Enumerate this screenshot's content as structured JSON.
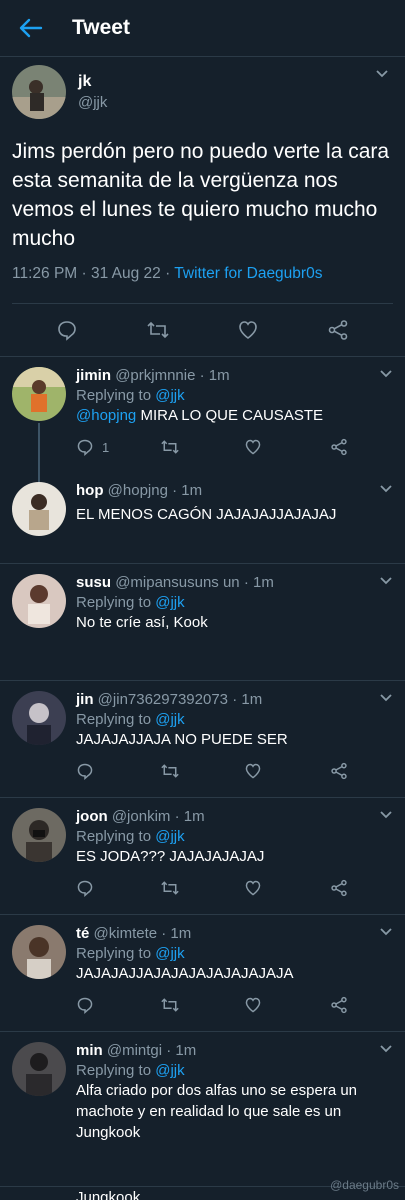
{
  "header": {
    "title": "Tweet"
  },
  "tweet": {
    "name": "jk",
    "handle": "@jjk",
    "text": "Jims perdón pero no puedo verte la cara esta semanita de la vergüenza nos vemos el lunes te quiero mucho mucho mucho",
    "time": "11:26 PM · 31 Aug 22 · ",
    "source": "Twitter for Daegubr0s"
  },
  "replies": [
    {
      "name": "jimin",
      "handle": "@prkjmnnie",
      "time": "· 1m",
      "replying": "Replying to ",
      "replying_to": "@jjk",
      "mention": "@hopjng",
      "text": " MIRA LO QUE CAUSASTE",
      "reply_count": "1"
    },
    {
      "name": "hop",
      "handle": "@hopjng",
      "time": "· 1m",
      "text": "EL MENOS CAGÓN JAJAJAJJAJAJAJ"
    },
    {
      "name": "susu",
      "handle": "@mipansusuns un",
      "time": "· 1m",
      "replying": "Replying to ",
      "replying_to": "@jjk",
      "text": "No te críe así, Kook"
    },
    {
      "name": "jin",
      "handle": "@jin736297392073",
      "time": "· 1m",
      "replying": "Replying to ",
      "replying_to": "@jjk",
      "text": "JAJAJAJJAJA NO PUEDE SER"
    },
    {
      "name": "joon",
      "handle": "@jonkim",
      "time": "· 1m",
      "replying": "Replying to ",
      "replying_to": "@jjk",
      "text": "ES JODA??? JAJAJAJAJAJ"
    },
    {
      "name": "té",
      "handle": "@kimtete",
      "time": "· 1m",
      "replying": "Replying to ",
      "replying_to": "@jjk",
      "text": "JAJAJAJJAJAJAJAJAJAJAJAJA"
    },
    {
      "name": "min",
      "handle": "@mintgi",
      "time": "· 1m",
      "replying": "Replying to ",
      "replying_to": "@jjk",
      "text": "Alfa criado por dos alfas uno se espera un machote y en realidad lo que sale es un Jungkook"
    }
  ],
  "cutoff_text": "Jungkook",
  "watermark": "@daegubr0s",
  "colors": {
    "background": "#15202b",
    "accent": "#1da1f2",
    "muted": "#8899a6",
    "divider": "#2b3a47"
  }
}
